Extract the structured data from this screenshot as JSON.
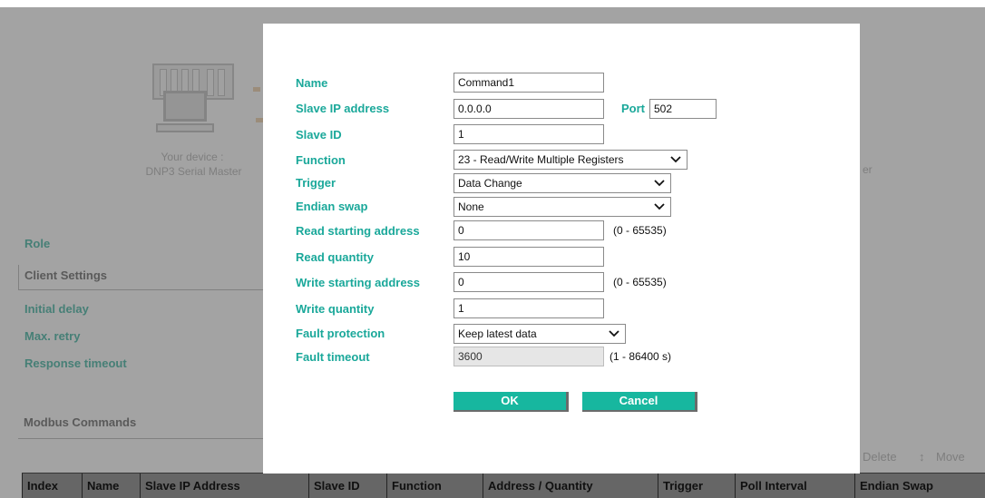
{
  "background": {
    "device_caption_line1": "Your device :",
    "device_caption_line2": "DNP3 Serial Master",
    "side_fragment": "er",
    "labels": {
      "role": "Role",
      "client_settings": "Client Settings",
      "initial_delay": "Initial delay",
      "max_retry": "Max. retry",
      "response_timeout": "Response timeout",
      "modbus_commands": "Modbus Commands"
    },
    "toolbar": {
      "delete": "Delete",
      "move": "Move"
    },
    "table_headers": [
      "Index",
      "Name",
      "Slave IP Address",
      "Slave ID",
      "Function",
      "Address / Quantity",
      "Trigger",
      "Poll Interval",
      "Endian Swap"
    ]
  },
  "dialog": {
    "name": {
      "label": "Name",
      "value": "Command1"
    },
    "slave_ip": {
      "label": "Slave IP address",
      "value": "0.0.0.0"
    },
    "port": {
      "label": "Port",
      "value": "502"
    },
    "slave_id": {
      "label": "Slave ID",
      "value": "1"
    },
    "function": {
      "label": "Function",
      "value": "23 - Read/Write Multiple Registers"
    },
    "trigger": {
      "label": "Trigger",
      "value": "Data Change"
    },
    "endian_swap": {
      "label": "Endian swap",
      "value": "None"
    },
    "read_start": {
      "label": "Read starting address",
      "value": "0",
      "hint": "(0 - 65535)"
    },
    "read_qty": {
      "label": "Read quantity",
      "value": "10"
    },
    "write_start": {
      "label": "Write starting address",
      "value": "0",
      "hint": "(0 - 65535)"
    },
    "write_qty": {
      "label": "Write quantity",
      "value": "1"
    },
    "fault_protection": {
      "label": "Fault protection",
      "value": "Keep latest data"
    },
    "fault_timeout": {
      "label": "Fault timeout",
      "value": "3600",
      "hint": "(1 - 86400 s)"
    },
    "ok_label": "OK",
    "cancel_label": "Cancel"
  },
  "colors": {
    "label_teal": "#1aa89a",
    "button_teal": "#17b79f",
    "overlay": "rgba(0,0,0,0.36)"
  }
}
